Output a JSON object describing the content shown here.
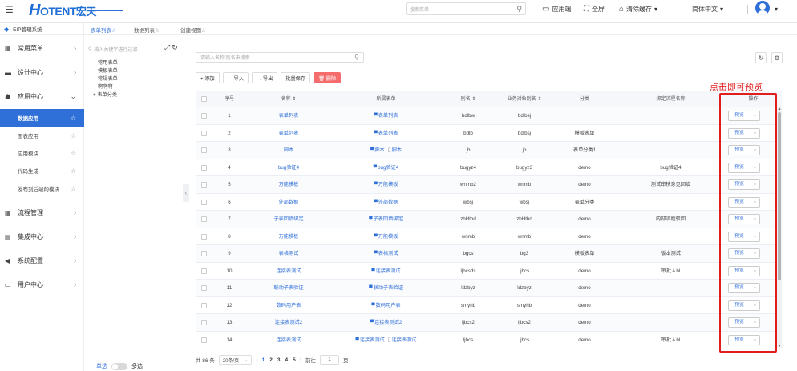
{
  "header": {
    "logo_letter": "H",
    "logo_text": "OTENT",
    "logo_cn": "宏天",
    "search_placeholder": "搜索菜单",
    "app_label": "应用端",
    "fullscreen_label": "全屏",
    "clear_cache_label": "清除缓存",
    "language_label": "简体中文"
  },
  "sidebar": {
    "system_title": "EIP管理系统",
    "items": [
      {
        "icon": "grid-icon",
        "glyph": "▦",
        "label": "常用菜单",
        "arrow": "›"
      },
      {
        "icon": "design-icon",
        "glyph": "▬",
        "label": "设计中心",
        "arrow": "›"
      },
      {
        "icon": "app-icon",
        "glyph": "☗",
        "label": "应用中心",
        "arrow": "⌄"
      }
    ],
    "sub_items": [
      {
        "label": "数据应用",
        "active": true
      },
      {
        "label": "图表应用",
        "active": false
      },
      {
        "label": "应用模块",
        "active": false
      },
      {
        "label": "代码生成",
        "active": false
      },
      {
        "label": "发布到后端的模块",
        "active": false
      }
    ],
    "items_after": [
      {
        "icon": "flow-icon",
        "glyph": "▦",
        "label": "流程管理",
        "arrow": "›"
      },
      {
        "icon": "integration-icon",
        "glyph": "▤",
        "label": "集成中心",
        "arrow": "›"
      },
      {
        "icon": "config-icon",
        "glyph": "◀",
        "label": "系统配置",
        "arrow": "›"
      },
      {
        "icon": "user-center-icon",
        "glyph": "▭",
        "label": "用户中心",
        "arrow": "›"
      }
    ]
  },
  "tabs": [
    {
      "label": "表单列表☆",
      "active": true
    },
    {
      "label": "数据列表☆",
      "active": false
    },
    {
      "label": "创建视图☆",
      "active": false
    }
  ],
  "tree": {
    "search_placeholder": "输入关键字进行过滤",
    "items": [
      {
        "label": "常用表单",
        "root": false
      },
      {
        "label": "模板表单",
        "root": false
      },
      {
        "label": "常规表单",
        "root": false
      },
      {
        "label": "啊啊啊",
        "root": false
      },
      {
        "label": "+ 表单分类",
        "root": true
      }
    ],
    "single_label": "单选",
    "multi_label": "多选"
  },
  "main": {
    "search_placeholder": "请输入名称,别名来搜索",
    "toolbar": [
      {
        "label": "+ 添加",
        "danger": false
      },
      {
        "label": "← 导入",
        "danger": false
      },
      {
        "label": "→ 导出",
        "danger": false
      },
      {
        "label": "批量保存",
        "danger": false
      },
      {
        "label": "🗑 删除",
        "danger": true
      }
    ],
    "annotation": "点击即可预览",
    "columns": [
      "序号",
      "名称 ⇕",
      "所属表单",
      "别名 ⇕",
      "业务对象别名 ⇕",
      "分类",
      "绑定流程名称",
      "操作"
    ],
    "preview_label": "预览",
    "rows": [
      {
        "no": "1",
        "name": "表单列表",
        "forms": [
          "表单列表"
        ],
        "alias": "bdlbw",
        "biz": "bdlbsj",
        "category": "",
        "flow": ""
      },
      {
        "no": "2",
        "name": "表单列表",
        "forms": [
          "表单列表"
        ],
        "alias": "bdlb",
        "biz": "bdlbsj",
        "category": "模板表单",
        "flow": ""
      },
      {
        "no": "3",
        "name": "脚本",
        "forms": [
          "脚本",
          "脚本"
        ],
        "alias": "jb",
        "biz": "jb",
        "category": "表单分类1",
        "flow": ""
      },
      {
        "no": "4",
        "name": "bug验证4",
        "forms": [
          "bug验证4"
        ],
        "alias": "bugyz4",
        "biz": "bugyz3",
        "category": "demo",
        "flow": "bug验证4"
      },
      {
        "no": "5",
        "name": "万能模板",
        "forms": [
          "万能模板"
        ],
        "alias": "wnmb2",
        "biz": "wnmb",
        "category": "demo",
        "flow": "测试审核意见回填"
      },
      {
        "no": "6",
        "name": "外部数据",
        "forms": [
          "外部数据"
        ],
        "alias": "wbsj",
        "biz": "wbsj",
        "category": "表单分类",
        "flow": ""
      },
      {
        "no": "7",
        "name": "子表回填绑定",
        "forms": [
          "子表回填绑定"
        ],
        "alias": "zbHtbd",
        "biz": "zbHtbd",
        "category": "demo",
        "flow": "内部流程驳回"
      },
      {
        "no": "8",
        "name": "万能模板",
        "forms": [
          "万能模板"
        ],
        "alias": "wnmb",
        "biz": "wnmb",
        "category": "demo",
        "flow": ""
      },
      {
        "no": "9",
        "name": "表格测试",
        "forms": [
          "表格测试"
        ],
        "alias": "bgcs",
        "biz": "bg3",
        "category": "模板表单",
        "flow": "版本测试"
      },
      {
        "no": "10",
        "name": "连接表测试",
        "forms": [
          "连接表测试"
        ],
        "alias": "ljbcsds",
        "biz": "ljbcs",
        "category": "demo",
        "flow": "审批人bl"
      },
      {
        "no": "11",
        "name": "联动子表验证",
        "forms": [
          "联动子表验证"
        ],
        "alias": "ldzbyz",
        "biz": "ldzbyz",
        "category": "demo",
        "flow": ""
      },
      {
        "no": "12",
        "name": "数码用户表",
        "forms": [
          "数码用户表"
        ],
        "alias": "smyhb",
        "biz": "smyhb",
        "category": "demo",
        "flow": ""
      },
      {
        "no": "13",
        "name": "连接表测试2",
        "forms": [
          "连接表测试2"
        ],
        "alias": "ljbcs2",
        "biz": "ljbcs2",
        "category": "demo",
        "flow": ""
      },
      {
        "no": "14",
        "name": "连接表测试",
        "forms": [
          "连接表测试",
          "连接表测试"
        ],
        "alias": "ljbcs",
        "biz": "ljbcs",
        "category": "demo",
        "flow": "审批人bl"
      }
    ]
  },
  "pagination": {
    "total": "共 86 条",
    "page_size": "20条/页",
    "pages": [
      "1",
      "2",
      "3",
      "4",
      "5"
    ],
    "current": "1",
    "goto_label": "前往",
    "goto_value": "1",
    "page_unit": "页"
  }
}
